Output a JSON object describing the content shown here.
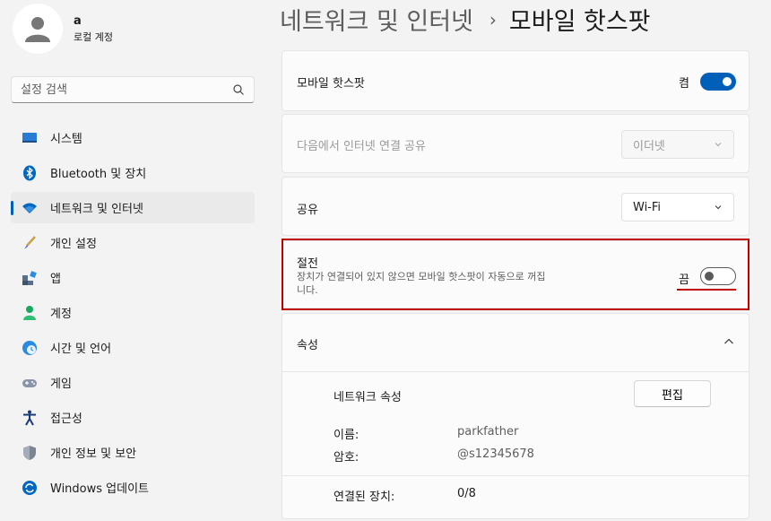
{
  "profile": {
    "name": "a",
    "account_type": "로컬 계정"
  },
  "search": {
    "placeholder": "설정 검색"
  },
  "nav": [
    {
      "label": "시스템",
      "icon": "system-icon"
    },
    {
      "label": "Bluetooth 및 장치",
      "icon": "bluetooth-icon"
    },
    {
      "label": "네트워크 및 인터넷",
      "icon": "wifi-icon",
      "active": true
    },
    {
      "label": "개인 설정",
      "icon": "brush-icon"
    },
    {
      "label": "앱",
      "icon": "apps-icon"
    },
    {
      "label": "계정",
      "icon": "account-icon"
    },
    {
      "label": "시간 및 언어",
      "icon": "time-language-icon"
    },
    {
      "label": "게임",
      "icon": "gamepad-icon"
    },
    {
      "label": "접근성",
      "icon": "accessibility-icon"
    },
    {
      "label": "개인 정보 및 보안",
      "icon": "shield-icon"
    },
    {
      "label": "Windows 업데이트",
      "icon": "update-icon"
    }
  ],
  "header": {
    "parent": "네트워크 및 인터넷",
    "separator": "›",
    "current": "모바일 핫스팟"
  },
  "hotspot": {
    "label": "모바일 핫스팟",
    "state_text": "켬",
    "enabled": true
  },
  "share_from": {
    "label": "다음에서 인터넷 연결 공유",
    "value": "이더넷",
    "disabled": true
  },
  "share_over": {
    "label": "공유",
    "value": "Wi-Fi"
  },
  "power_saving": {
    "title": "절전",
    "description_line1": "장치가 연결되어 있지 않으면 모바일 핫스팟이 자동으로 꺼집",
    "description_line2": "니다.",
    "state_text": "끔",
    "enabled": false
  },
  "properties": {
    "header": "속성",
    "network_props_label": "네트워크 속성",
    "edit_label": "편집",
    "name_label": "이름:",
    "name_value": "parkfather",
    "password_label": "암호:",
    "password_value": "@s12345678",
    "connected_label": "연결된 장치:",
    "connected_value": "0/8"
  },
  "colors": {
    "accent": "#005fb8",
    "annotation": "#c00000"
  }
}
